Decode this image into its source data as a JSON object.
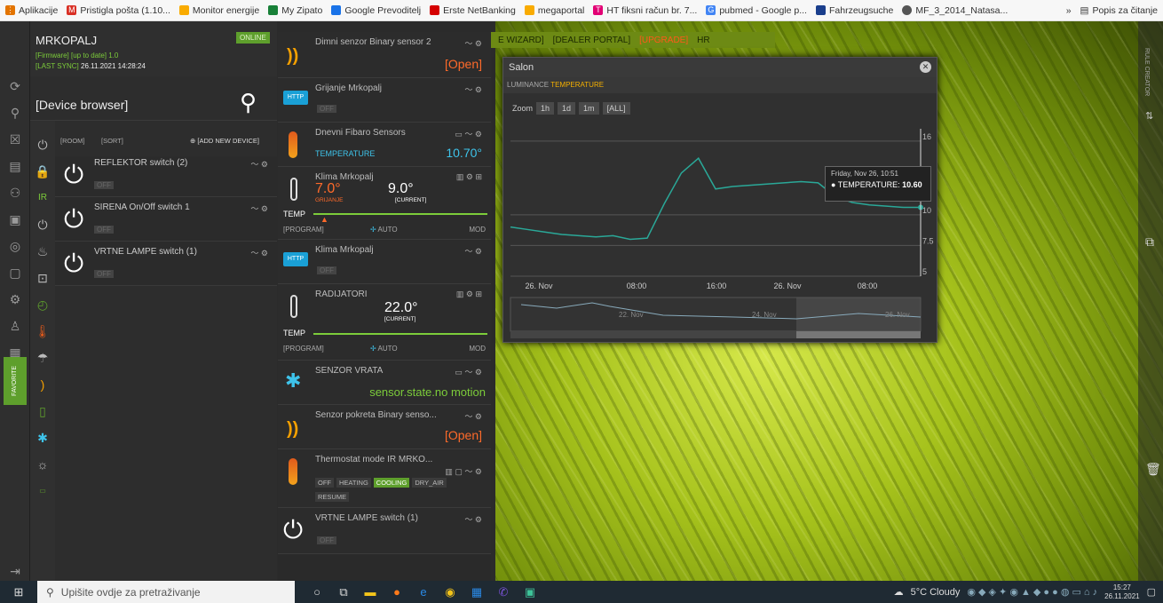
{
  "bookmarks": [
    {
      "label": "Aplikacije",
      "color": "#e37400"
    },
    {
      "label": "Pristigla pošta (1.10...",
      "color": "#d93025"
    },
    {
      "label": "Monitor energije",
      "color": "#f9ab00"
    },
    {
      "label": "My Zipato",
      "color": "#188038"
    },
    {
      "label": "Google Prevoditelj",
      "color": "#1a73e8"
    },
    {
      "label": "Erste NetBanking",
      "color": "#d50000"
    },
    {
      "label": "megaportal",
      "color": "#f9ab00"
    },
    {
      "label": "HT fiksni račun br. 7...",
      "color": "#e20074"
    },
    {
      "label": "pubmed - Google p...",
      "color": "#4285f4"
    },
    {
      "label": "Fahrzeugsuche",
      "color": "#1a3e8c"
    },
    {
      "label": "MF_3_2014_Natasa...",
      "color": "#555555"
    }
  ],
  "bookmarks_more": "»",
  "reading_list": "Popis za čitanje",
  "header": {
    "title": "MRKOPALJ",
    "status": "ONLINE",
    "firmware": "[Firmware] [up to date] 1.0",
    "last_sync_label": "[LAST SYNC]",
    "last_sync": "26.11.2021 14:28:24"
  },
  "browser": {
    "title": "[Device browser]",
    "room": "[ROOM]",
    "sort": "[SORT]",
    "add": "[ADD NEW DEVICE]"
  },
  "devices": [
    {
      "name": "REFLEKTOR switch (2)",
      "state": "OFF"
    },
    {
      "name": "SIRENA On/Off switch 1",
      "state": "OFF"
    },
    {
      "name": "VRTNE LAMPE switch (1)",
      "state": "OFF"
    }
  ],
  "favorite_label": "FAVORITE",
  "widgets": {
    "w1": {
      "title": "Dimni senzor Binary sensor 2",
      "value": "[Open]"
    },
    "w2": {
      "title": "Grijanje Mrkopalj",
      "badge": "HTTP",
      "state": "OFF"
    },
    "w3": {
      "title": "Dnevni Fibaro Sensors",
      "label": "TEMPERATURE",
      "value": "10.70°"
    },
    "w4": {
      "title": "Klima Mrkopalj",
      "set": "7.0°",
      "set_label": "GRIJANJE",
      "current": "9.0°",
      "current_label": "[CURRENT]",
      "temp": "TEMP",
      "program": "[PROGRAM]",
      "auto": "AUTO",
      "mode": "MOD"
    },
    "w5": {
      "title": "Klima Mrkopalj",
      "badge": "HTTP",
      "state": "OFF"
    },
    "w6": {
      "title": "RADIJATORI",
      "current": "22.0°",
      "current_label": "[CURRENT]",
      "temp": "TEMP",
      "program": "[PROGRAM]",
      "auto": "AUTO",
      "mode": "MOD"
    },
    "w7": {
      "title": "SENZOR VRATA",
      "value": "sensor.state.no motion"
    },
    "w8": {
      "title": "Senzor pokreta Binary senso...",
      "value": "[Open]"
    },
    "w9": {
      "title": "Thermostat mode IR MRKO...",
      "modes": [
        "OFF",
        "HEATING",
        "COOLING",
        "DRY_AIR",
        "RESUME"
      ]
    },
    "w10": {
      "title": "VRTNE LAMPE switch (1)",
      "state": "OFF"
    }
  },
  "topnav": {
    "wizard": "E WIZARD]",
    "dealer": "[DEALER PORTAL]",
    "upgrade": "[UPGRADE]",
    "hr": "HR"
  },
  "chart_window": {
    "title": "Salon",
    "tab1": "LUMINANCE",
    "tab2": "TEMPERATURE",
    "zoom": "Zoom",
    "z1": "1h",
    "z2": "1d",
    "z3": "1m",
    "z4": "[ALL]",
    "tooltip_date": "Friday, Nov 26, 10:51",
    "tooltip_label": "TEMPERATURE:",
    "tooltip_value": "10.60"
  },
  "chart_data": {
    "type": "line",
    "series": [
      {
        "name": "TEMPERATURE",
        "values": [
          9.0,
          8.8,
          8.6,
          8.4,
          8.3,
          8.2,
          8.3,
          8.0,
          8.1,
          10.9,
          13.4,
          14.6,
          12.1,
          12.3,
          12.4,
          12.5,
          12.6,
          12.7,
          12.6,
          11.5,
          11.0,
          10.8,
          10.7,
          10.6,
          10.6
        ]
      }
    ],
    "x_tick_labels": [
      "26. Nov",
      "08:00",
      "16:00",
      "26. Nov",
      "08:00"
    ],
    "y_tick_labels": [
      "16",
      "10",
      "7.5",
      "5"
    ],
    "ylim": [
      5,
      17
    ],
    "navigator_labels": [
      "22. Nov",
      "24. Nov",
      "26. Nov"
    ]
  },
  "right_strip": {
    "rule_creator": "RULE CREATOR"
  },
  "taskbar": {
    "search": "Upišite ovdje za pretraživanje",
    "weather": "5°C Cloudy",
    "time": "15:27",
    "date": "26.11.2021"
  }
}
